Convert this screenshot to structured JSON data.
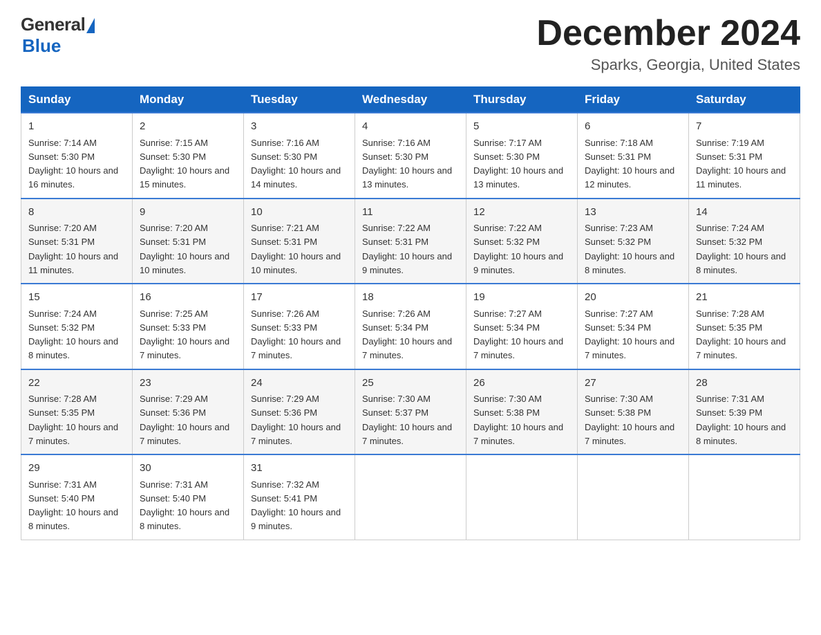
{
  "logo": {
    "general": "General",
    "blue": "Blue"
  },
  "title": "December 2024",
  "location": "Sparks, Georgia, United States",
  "days_of_week": [
    "Sunday",
    "Monday",
    "Tuesday",
    "Wednesday",
    "Thursday",
    "Friday",
    "Saturday"
  ],
  "weeks": [
    [
      {
        "day": "1",
        "sunrise": "7:14 AM",
        "sunset": "5:30 PM",
        "daylight": "10 hours and 16 minutes."
      },
      {
        "day": "2",
        "sunrise": "7:15 AM",
        "sunset": "5:30 PM",
        "daylight": "10 hours and 15 minutes."
      },
      {
        "day": "3",
        "sunrise": "7:16 AM",
        "sunset": "5:30 PM",
        "daylight": "10 hours and 14 minutes."
      },
      {
        "day": "4",
        "sunrise": "7:16 AM",
        "sunset": "5:30 PM",
        "daylight": "10 hours and 13 minutes."
      },
      {
        "day": "5",
        "sunrise": "7:17 AM",
        "sunset": "5:30 PM",
        "daylight": "10 hours and 13 minutes."
      },
      {
        "day": "6",
        "sunrise": "7:18 AM",
        "sunset": "5:31 PM",
        "daylight": "10 hours and 12 minutes."
      },
      {
        "day": "7",
        "sunrise": "7:19 AM",
        "sunset": "5:31 PM",
        "daylight": "10 hours and 11 minutes."
      }
    ],
    [
      {
        "day": "8",
        "sunrise": "7:20 AM",
        "sunset": "5:31 PM",
        "daylight": "10 hours and 11 minutes."
      },
      {
        "day": "9",
        "sunrise": "7:20 AM",
        "sunset": "5:31 PM",
        "daylight": "10 hours and 10 minutes."
      },
      {
        "day": "10",
        "sunrise": "7:21 AM",
        "sunset": "5:31 PM",
        "daylight": "10 hours and 10 minutes."
      },
      {
        "day": "11",
        "sunrise": "7:22 AM",
        "sunset": "5:31 PM",
        "daylight": "10 hours and 9 minutes."
      },
      {
        "day": "12",
        "sunrise": "7:22 AM",
        "sunset": "5:32 PM",
        "daylight": "10 hours and 9 minutes."
      },
      {
        "day": "13",
        "sunrise": "7:23 AM",
        "sunset": "5:32 PM",
        "daylight": "10 hours and 8 minutes."
      },
      {
        "day": "14",
        "sunrise": "7:24 AM",
        "sunset": "5:32 PM",
        "daylight": "10 hours and 8 minutes."
      }
    ],
    [
      {
        "day": "15",
        "sunrise": "7:24 AM",
        "sunset": "5:32 PM",
        "daylight": "10 hours and 8 minutes."
      },
      {
        "day": "16",
        "sunrise": "7:25 AM",
        "sunset": "5:33 PM",
        "daylight": "10 hours and 7 minutes."
      },
      {
        "day": "17",
        "sunrise": "7:26 AM",
        "sunset": "5:33 PM",
        "daylight": "10 hours and 7 minutes."
      },
      {
        "day": "18",
        "sunrise": "7:26 AM",
        "sunset": "5:34 PM",
        "daylight": "10 hours and 7 minutes."
      },
      {
        "day": "19",
        "sunrise": "7:27 AM",
        "sunset": "5:34 PM",
        "daylight": "10 hours and 7 minutes."
      },
      {
        "day": "20",
        "sunrise": "7:27 AM",
        "sunset": "5:34 PM",
        "daylight": "10 hours and 7 minutes."
      },
      {
        "day": "21",
        "sunrise": "7:28 AM",
        "sunset": "5:35 PM",
        "daylight": "10 hours and 7 minutes."
      }
    ],
    [
      {
        "day": "22",
        "sunrise": "7:28 AM",
        "sunset": "5:35 PM",
        "daylight": "10 hours and 7 minutes."
      },
      {
        "day": "23",
        "sunrise": "7:29 AM",
        "sunset": "5:36 PM",
        "daylight": "10 hours and 7 minutes."
      },
      {
        "day": "24",
        "sunrise": "7:29 AM",
        "sunset": "5:36 PM",
        "daylight": "10 hours and 7 minutes."
      },
      {
        "day": "25",
        "sunrise": "7:30 AM",
        "sunset": "5:37 PM",
        "daylight": "10 hours and 7 minutes."
      },
      {
        "day": "26",
        "sunrise": "7:30 AM",
        "sunset": "5:38 PM",
        "daylight": "10 hours and 7 minutes."
      },
      {
        "day": "27",
        "sunrise": "7:30 AM",
        "sunset": "5:38 PM",
        "daylight": "10 hours and 7 minutes."
      },
      {
        "day": "28",
        "sunrise": "7:31 AM",
        "sunset": "5:39 PM",
        "daylight": "10 hours and 8 minutes."
      }
    ],
    [
      {
        "day": "29",
        "sunrise": "7:31 AM",
        "sunset": "5:40 PM",
        "daylight": "10 hours and 8 minutes."
      },
      {
        "day": "30",
        "sunrise": "7:31 AM",
        "sunset": "5:40 PM",
        "daylight": "10 hours and 8 minutes."
      },
      {
        "day": "31",
        "sunrise": "7:32 AM",
        "sunset": "5:41 PM",
        "daylight": "10 hours and 9 minutes."
      },
      null,
      null,
      null,
      null
    ]
  ]
}
